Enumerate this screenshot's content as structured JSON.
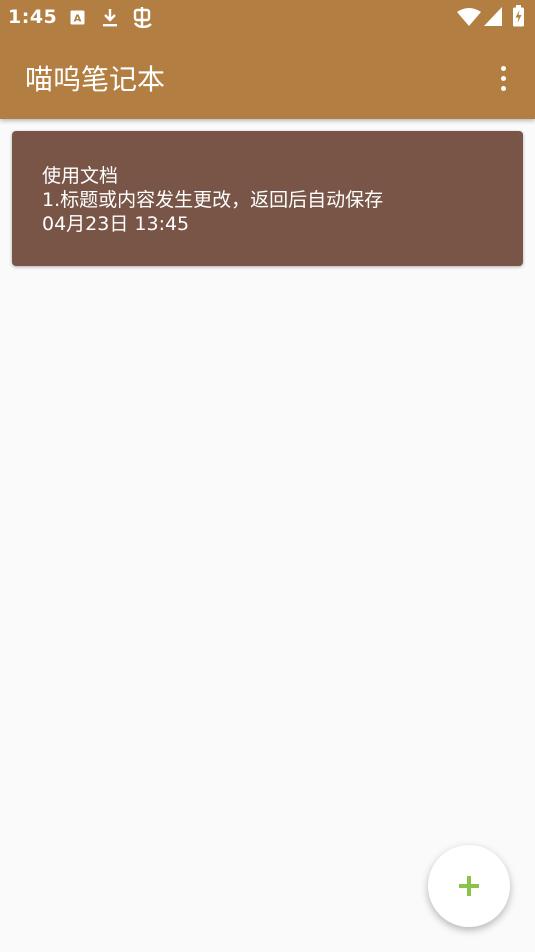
{
  "status_bar": {
    "time": "1:45",
    "left_icons": [
      "font-a-icon",
      "download-icon",
      "bug-icon"
    ],
    "right_icons": [
      "wifi-icon",
      "signal-icon",
      "battery-charging-icon"
    ]
  },
  "app_bar": {
    "title": "喵呜笔记本",
    "menu_icon": "more-vert-icon",
    "background_color": "#B27E41"
  },
  "notes": [
    {
      "title": "使用文档",
      "content": "1.标题或内容发生更改，返回后自动保存",
      "date": "04月23日 13:45",
      "background_color": "#795548"
    }
  ],
  "fab": {
    "icon": "plus-icon",
    "icon_color": "#8BC34A"
  },
  "colors": {
    "page_background": "#FAFAFA",
    "text_on_dark": "#FFFFFF"
  }
}
